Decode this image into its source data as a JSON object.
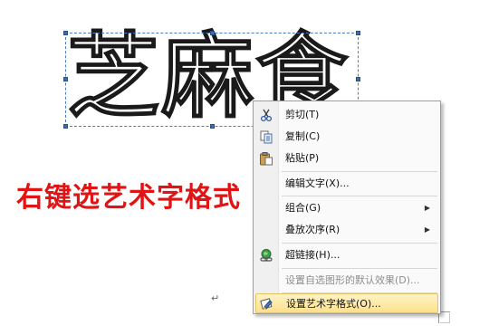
{
  "wordart": {
    "text": "芝麻食"
  },
  "caption": {
    "text": "右键选艺术字格式"
  },
  "document": {
    "paragraph_mark": "↵"
  },
  "context_menu": {
    "items": [
      {
        "label": "剪切(T)",
        "icon": "scissors-icon",
        "enabled": true
      },
      {
        "label": "复制(C)",
        "icon": "copy-icon",
        "enabled": true
      },
      {
        "label": "粘贴(P)",
        "icon": "paste-icon",
        "enabled": true
      },
      {
        "label": "编辑文字(X)...",
        "icon": "",
        "enabled": true
      },
      {
        "label": "组合(G)",
        "icon": "",
        "enabled": true,
        "submenu": true
      },
      {
        "label": "叠放次序(R)",
        "icon": "",
        "enabled": true,
        "submenu": true
      },
      {
        "label": "超链接(H)...",
        "icon": "hyperlink-globe-icon",
        "enabled": true
      },
      {
        "label": "设置自选图形的默认效果(D)...",
        "icon": "",
        "enabled": false
      },
      {
        "label": "设置艺术字格式(O)...",
        "icon": "format-wordart-icon",
        "enabled": true,
        "highlighted": true
      }
    ],
    "submenu_arrow": "▶"
  },
  "colors": {
    "caption": "#e01414",
    "selection_frame": "#4a7fbf",
    "menu_highlight": "#ffe18a"
  }
}
